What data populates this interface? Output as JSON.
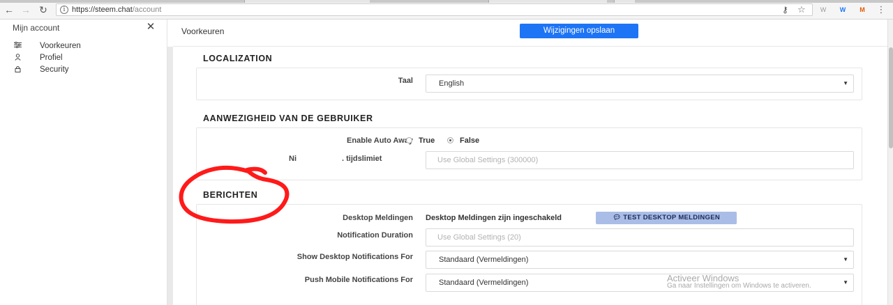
{
  "browser": {
    "url_host": "https://steem.chat",
    "url_path": "/account",
    "back_glyph": "←",
    "forward_glyph": "→",
    "reload_glyph": "↻",
    "info_glyph": "i",
    "extensions": [
      "W",
      "W",
      "M"
    ]
  },
  "sidebar": {
    "title": "Mijn account",
    "close_glyph": "✕",
    "items": [
      {
        "label": "Voorkeuren",
        "icon": "sliders-icon"
      },
      {
        "label": "Profiel",
        "icon": "user-icon"
      },
      {
        "label": "Security",
        "icon": "lock-icon"
      }
    ]
  },
  "header": {
    "title": "Voorkeuren",
    "save_label": "Wijzigingen opslaan"
  },
  "localization": {
    "title": "LOCALIZATION",
    "language_label": "Taal",
    "language_value": "English"
  },
  "presence": {
    "title": "AANWEZIGHEID VAN DE GEBRUIKER",
    "auto_away_label": "Enable Auto Away",
    "true_label": "True",
    "false_label": "False",
    "auto_away_selected": "False",
    "idle_label_start": "Ni",
    "idle_label_end": "tijdslimiet",
    "idle_placeholder": "Use Global Settings (300000)"
  },
  "messages": {
    "title": "BERICHTEN",
    "desktop_label": "Desktop Meldingen",
    "desktop_status": "Desktop Meldingen zijn ingeschakeld",
    "test_button": "TEST DESKTOP MELDINGEN",
    "duration_label": "Notification Duration",
    "duration_placeholder": "Use Global Settings (20)",
    "desktop_for_label": "Show Desktop Notifications For",
    "desktop_for_value": "Standaard (Vermeldingen)",
    "mobile_for_label": "Push Mobile Notifications For",
    "mobile_for_value": "Standaard (Vermeldingen)"
  },
  "colors": {
    "primary": "#1d74f5",
    "test_button_bg": "#a9bde6",
    "annotation": "#ff0000"
  },
  "watermark": {
    "line1": "Activeer Windows",
    "line2": "Ga naar Instellingen om Windows te activeren."
  }
}
